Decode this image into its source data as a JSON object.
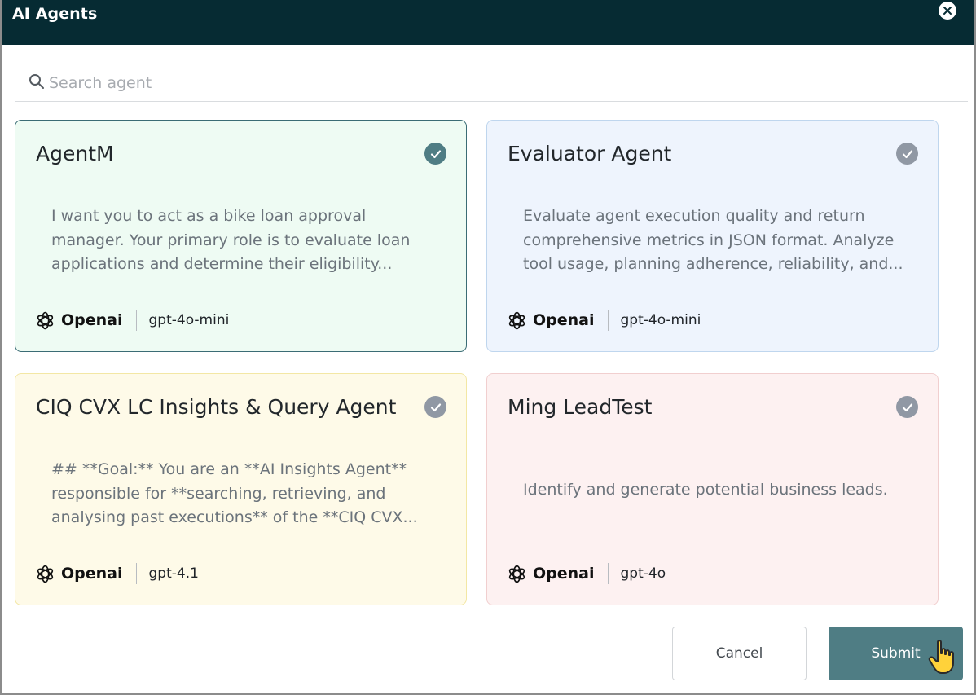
{
  "dialog": {
    "title": "AI Agents",
    "close_icon": "close-circle-icon"
  },
  "search": {
    "placeholder": "Search agent",
    "value": "",
    "icon": "search-icon"
  },
  "agents": [
    {
      "name": "AgentM",
      "description": "I want you to act as a bike loan approval manager. Your primary role is to evaluate loan applications and determine their eligibility...",
      "provider": "Openai",
      "model": "gpt-4o-mini",
      "selected": true,
      "color": "#eefbf3"
    },
    {
      "name": "Evaluator Agent",
      "description": "Evaluate agent execution quality and return comprehensive metrics in JSON format. Analyze tool usage, planning adherence, reliability, and...",
      "provider": "Openai",
      "model": "gpt-4o-mini",
      "selected": false,
      "color": "#eef4fd"
    },
    {
      "name": "CIQ CVX LC Insights & Query Agent",
      "description": "## **Goal:** You are an **AI Insights Agent** responsible for **searching, retrieving, and analysing past executions** of the **CIQ CVX...",
      "provider": "Openai",
      "model": "gpt-4.1",
      "selected": false,
      "color": "#fefae8"
    },
    {
      "name": "Ming LeadTest",
      "description": "Identify and generate potential business leads.",
      "provider": "Openai",
      "model": "gpt-4o",
      "selected": false,
      "color": "#fdf1f1"
    }
  ],
  "actions": {
    "cancel_label": "Cancel",
    "submit_label": "Submit"
  },
  "colors": {
    "header_bg": "#062b33",
    "accent": "#4f7d84",
    "check_inactive": "#9098a4"
  }
}
